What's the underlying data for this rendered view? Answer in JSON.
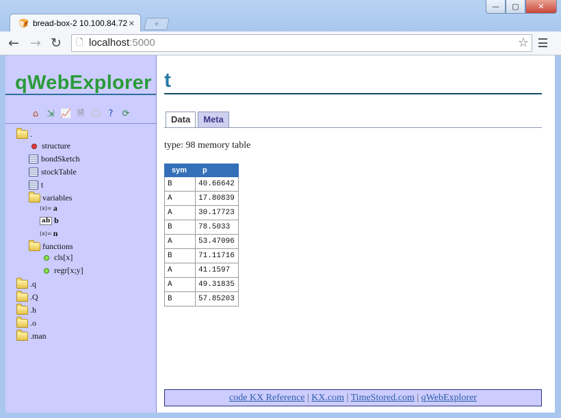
{
  "browser": {
    "tab_title": "bread-box-2 10.100.84.72",
    "url_host": "localhost",
    "url_port": ":5000",
    "controls": {
      "minimize": "—",
      "maximize": "▢",
      "close": "✕"
    }
  },
  "sidebar": {
    "brand": "qWebExplorer",
    "toolbar_icons": [
      "home-icon",
      "export-icon",
      "chart-icon",
      "document-icon",
      "folder-icon",
      "help-icon",
      "refresh-icon"
    ],
    "tree": {
      "root": ".",
      "structure": "structure",
      "tables": [
        "bondSketch",
        "stockTable",
        "t"
      ],
      "variables_label": "variables",
      "variables": {
        "a": "a",
        "b": "b",
        "n": "n"
      },
      "functions_label": "functions",
      "functions": [
        "cls[x]",
        "regr[x;y]"
      ],
      "namespaces": [
        ".q",
        ".Q",
        ".h",
        ".o",
        ".man"
      ]
    }
  },
  "main": {
    "title": "t",
    "tabs": {
      "data": "Data",
      "meta": "Meta"
    },
    "type_info": "type: 98 memory table",
    "table": {
      "columns": [
        "sym",
        "p"
      ],
      "rows": [
        [
          "B",
          "40.66642"
        ],
        [
          "A",
          "17.80839"
        ],
        [
          "A",
          "30.17723"
        ],
        [
          "B",
          "78.5033"
        ],
        [
          "A",
          "53.47096"
        ],
        [
          "B",
          "71.11716"
        ],
        [
          "A",
          "41.1597"
        ],
        [
          "A",
          "49.31835"
        ],
        [
          "B",
          "57.85203"
        ]
      ]
    },
    "footer": {
      "link1": "code KX Reference",
      "link2": "KX.com",
      "link3": "TimeStored.com",
      "link4": "qWebExplorer",
      "separator": "|"
    }
  }
}
